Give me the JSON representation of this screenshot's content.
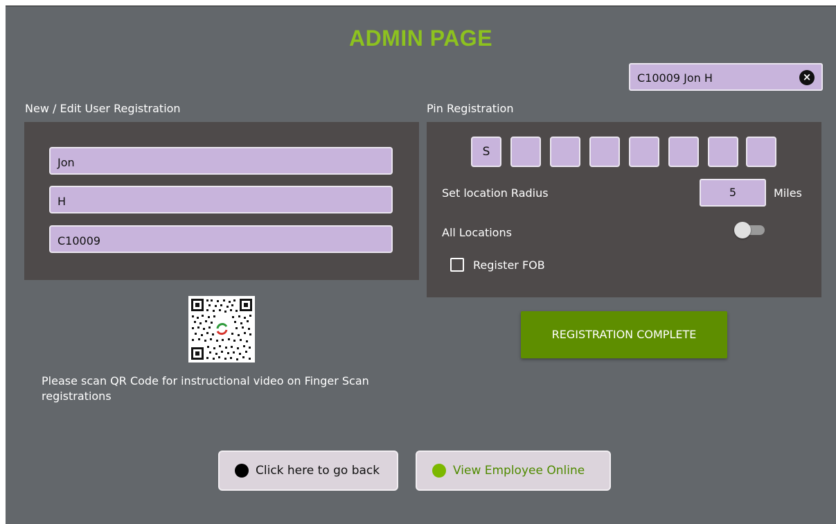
{
  "page": {
    "title": "ADMIN PAGE"
  },
  "selected_user": {
    "label": "C10009 Jon H",
    "clear_icon": "close-circle-icon"
  },
  "user_registration": {
    "heading": "New / Edit User Registration",
    "first_name": "Jon",
    "last_name": "H",
    "user_id": "C10009"
  },
  "pin_registration": {
    "heading": "Pin Registration",
    "pin_chars": [
      "S",
      "",
      "",
      "",
      "",
      "",
      "",
      ""
    ],
    "radius_label": "Set location Radius",
    "radius_value": "5",
    "radius_unit": "Miles",
    "all_locations_label": "All Locations",
    "all_locations_on": false,
    "register_fob_label": "Register FOB",
    "register_fob_checked": false
  },
  "registration_complete_label": "REGISTRATION COMPLETE",
  "qr_note": "Please scan QR Code for instructional video on Finger Scan registrations",
  "footer": {
    "back_label": "Click here to go back",
    "online_label": "View Employee Online"
  },
  "colors": {
    "background": "#63676b",
    "panel": "#4e4a4a",
    "accent_green": "#8dc21f",
    "button_green": "#5e8e00",
    "field_purple": "#c8b4dc"
  }
}
